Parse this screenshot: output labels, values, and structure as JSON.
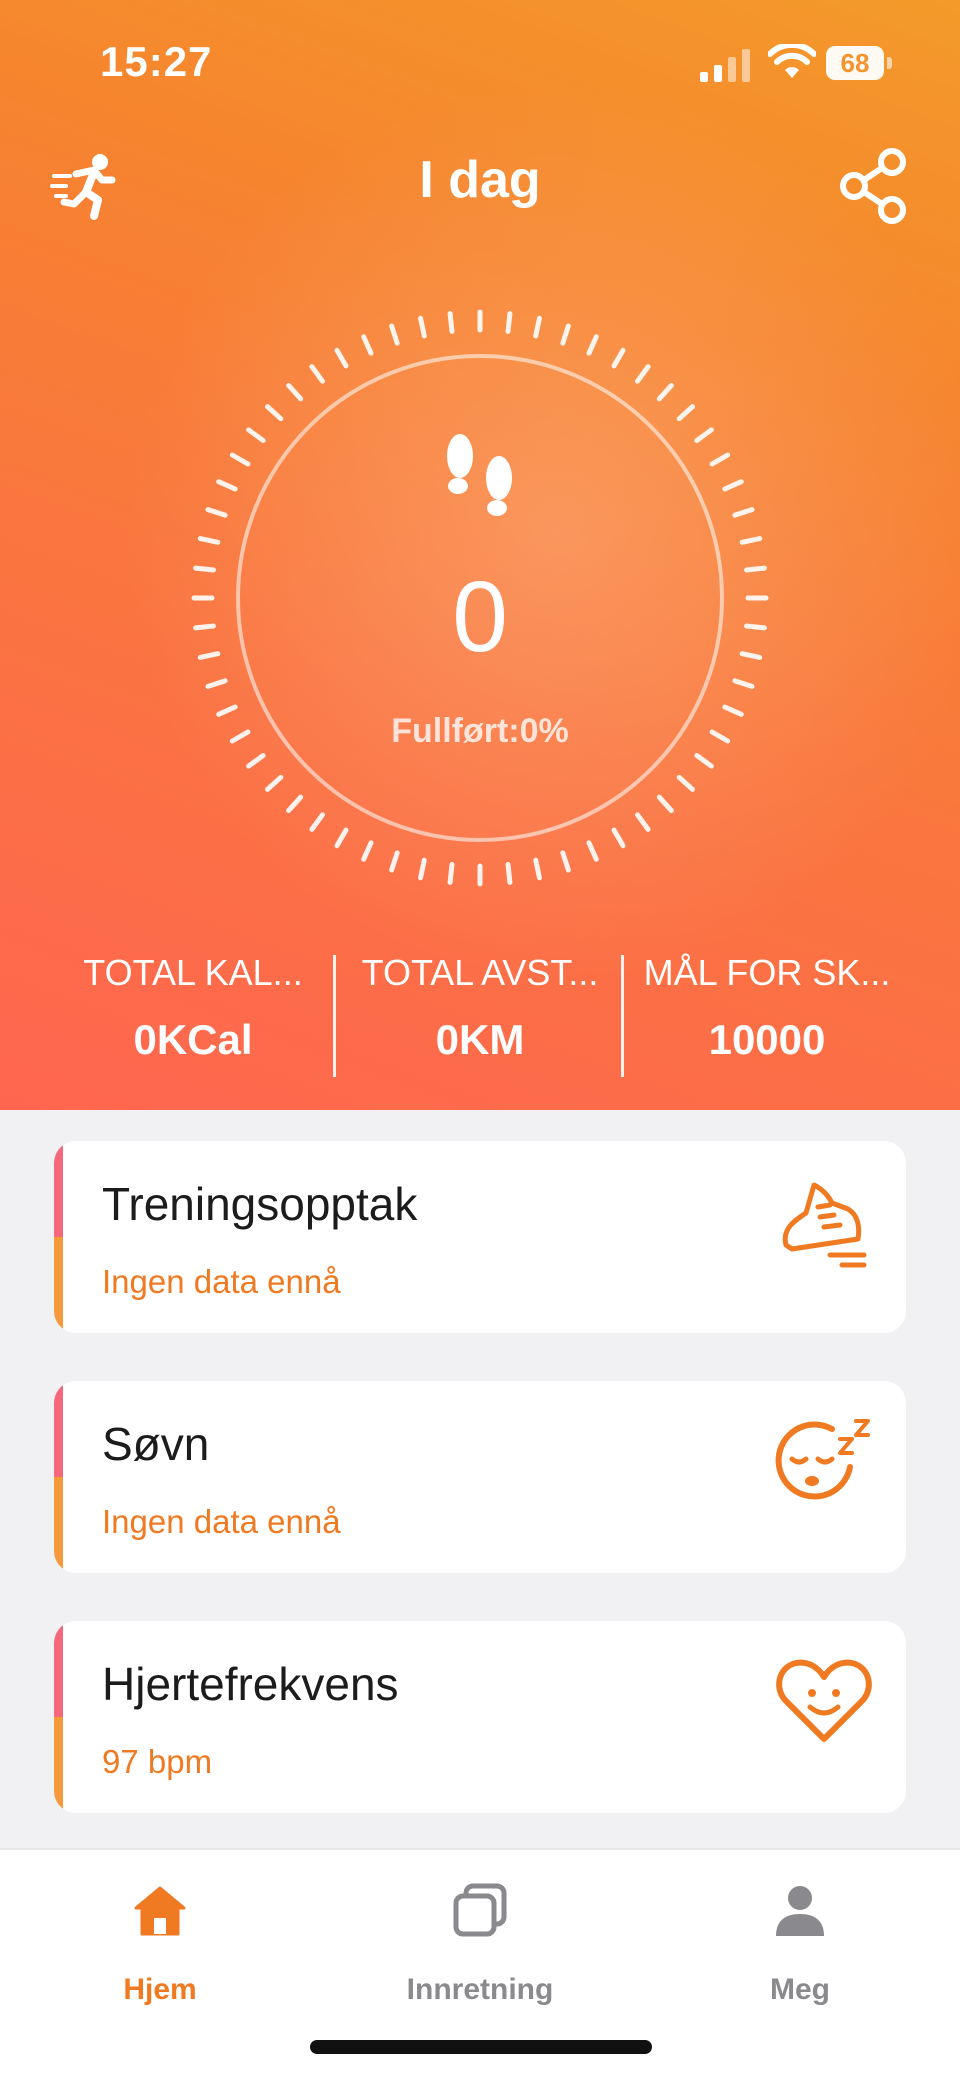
{
  "status_bar": {
    "time": "15:27",
    "battery": "68"
  },
  "header": {
    "title": "I dag"
  },
  "steps": {
    "value": "0",
    "completed_text": "Fullført:0%",
    "progress_percent": 0
  },
  "stats": [
    {
      "label": "TOTAL KAL...",
      "value": "0KCal"
    },
    {
      "label": "TOTAL AVST...",
      "value": "0KM"
    },
    {
      "label": "MÅL FOR SK...",
      "value": "10000"
    }
  ],
  "cards": [
    {
      "title": "Treningsopptak",
      "subtitle": "Ingen data ennå",
      "icon": "running-shoe-icon"
    },
    {
      "title": "Søvn",
      "subtitle": "Ingen data ennå",
      "icon": "sleep-face-icon"
    },
    {
      "title": "Hjertefrekvens",
      "subtitle": "97 bpm",
      "icon": "heart-smile-icon"
    }
  ],
  "tabs": [
    {
      "label": "Hjem",
      "icon": "home-icon",
      "active": true
    },
    {
      "label": "Innretning",
      "icon": "device-icon",
      "active": false
    },
    {
      "label": "Meg",
      "icon": "person-icon",
      "active": false
    }
  ],
  "colors": {
    "accent": "#f07a22",
    "tab_inactive": "#8a8a8e",
    "hero_top": "#f39a2a",
    "hero_bottom": "#ff6650"
  }
}
